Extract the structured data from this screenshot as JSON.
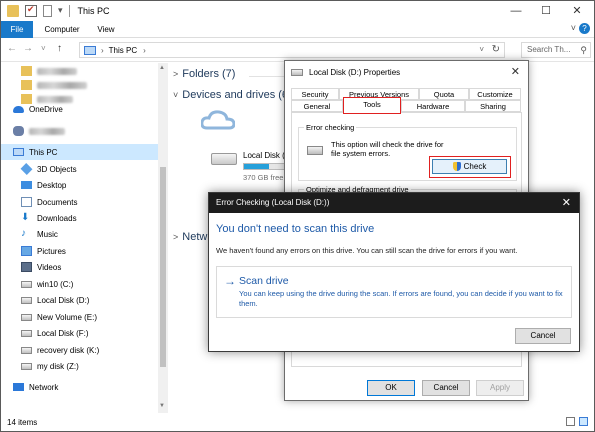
{
  "window": {
    "title": "This PC",
    "minimize": "—",
    "maximize": "☐",
    "close": "✕"
  },
  "ribbon": {
    "tabs": [
      "File",
      "Computer",
      "View"
    ],
    "expand": "˅",
    "help": "?"
  },
  "address": {
    "back": "←",
    "forward": "→",
    "recent": "˅",
    "up": "↑",
    "crumb_sep": "›",
    "crumb": "This PC",
    "crumb_after": "›",
    "dropdown": "˅",
    "refresh": "↻",
    "search_placeholder": "Search Th..."
  },
  "sidebar": {
    "items": [
      {
        "label": "OneDrive",
        "icon": "cloud-icon"
      },
      {
        "label": "This PC",
        "icon": "computer-icon"
      },
      {
        "label": "3D Objects",
        "icon": "cube-icon"
      },
      {
        "label": "Desktop",
        "icon": "desktop-icon"
      },
      {
        "label": "Documents",
        "icon": "documents-icon"
      },
      {
        "label": "Downloads",
        "icon": "download-icon"
      },
      {
        "label": "Music",
        "icon": "music-icon"
      },
      {
        "label": "Pictures",
        "icon": "pictures-icon"
      },
      {
        "label": "Videos",
        "icon": "videos-icon"
      },
      {
        "label": "win10 (C:)",
        "icon": "windows-drive-icon"
      },
      {
        "label": "Local Disk (D:)",
        "icon": "drive-icon"
      },
      {
        "label": "New Volume (E:)",
        "icon": "drive-icon"
      },
      {
        "label": "Local Disk (F:)",
        "icon": "drive-icon"
      },
      {
        "label": "recovery disk (K:)",
        "icon": "drive-icon"
      },
      {
        "label": "my disk (Z:)",
        "icon": "drive-icon"
      },
      {
        "label": "Network",
        "icon": "network-icon"
      }
    ]
  },
  "content": {
    "folders_header": "Folders (7)",
    "devices_header": "Devices and drives (6)",
    "network_header": "Netw",
    "drive_name": "Local Disk (",
    "drive_free": "370 GB free"
  },
  "status": {
    "items_count": "14 items"
  },
  "properties": {
    "title": "Local Disk (D:) Properties",
    "close": "✕",
    "tabs_row1": [
      "Security",
      "Previous Versions",
      "Quota",
      "Customize"
    ],
    "tabs_row2": [
      "General",
      "Tools",
      "Hardware",
      "Sharing"
    ],
    "error_checking_legend": "Error checking",
    "error_checking_text": "This option will check the drive for file system errors.",
    "check_label": "Check",
    "optimize_legend": "Optimize and defragment drive",
    "buttons": {
      "ok": "OK",
      "cancel": "Cancel",
      "apply": "Apply"
    }
  },
  "error_dialog": {
    "title": "Error Checking (Local Disk (D:))",
    "close": "✕",
    "heading": "You don't need to scan this drive",
    "body": "We haven't found any errors on this drive. You can still scan the drive for errors if you want.",
    "scan_arrow": "→",
    "scan_title": "Scan drive",
    "scan_desc": "You can keep using the drive during the scan. If errors are found, you can decide if you want to fix them.",
    "cancel": "Cancel"
  },
  "colors": {
    "accent": "#1979ca",
    "link_blue": "#1e5aa8",
    "highlight_red": "#e02020",
    "selected_bg": "#cce8ff"
  }
}
